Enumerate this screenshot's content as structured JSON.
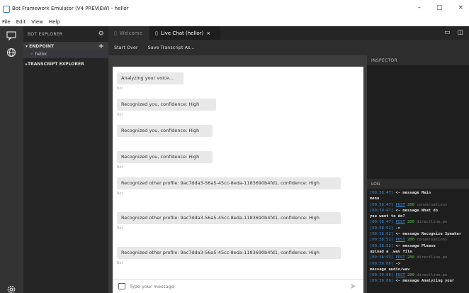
{
  "window": {
    "title": "Bot Framework Emulator (V4 PREVIEW) - hellor",
    "controls": [
      "–",
      "□",
      "×"
    ]
  },
  "menu": [
    "File",
    "Edit",
    "View",
    "Help"
  ],
  "sidebar": {
    "header": "BOT EXPLORER",
    "endpoint_section": "ENDPOINT",
    "endpoint_item": "hellor",
    "transcript_section": "TRANSCRIPT EXPLORER"
  },
  "tabs": [
    {
      "label": "Welcome"
    },
    {
      "label": "Live Chat (hellor)"
    }
  ],
  "toolbar": {
    "start_over": "Start Over",
    "save_transcript": "Save Transcript As..."
  },
  "chat": {
    "messages": [
      {
        "text": "Analyzing your voice...",
        "ts": "Bot"
      },
      {
        "text": "Recognized you, confidence: High",
        "ts": "Bot"
      },
      {
        "text": "Recognized you, confidence: High",
        "ts": ""
      },
      {
        "text": "Recognized you, confidence: High",
        "ts": "Bot"
      },
      {
        "text": "Recognized other profile: 9ac7dda3-56a5-45cc-8eda-1183690b4fd1, confidence: High",
        "ts": "Bot"
      },
      {
        "text": "Recognized other profile: 9ac7dda3-56a5-45cc-8eda-1183690b4fd1, confidence: High",
        "ts": "Bot"
      },
      {
        "text": "Recognized other profile: 9ac7dda3-56a5-45cc-8eda-1183690b4fd1, confidence: High",
        "ts": "Bot"
      }
    ],
    "input_placeholder": "Type your message"
  },
  "inspector": {
    "header": "INSPECTOR"
  },
  "log": {
    "header": "LOG",
    "lines": [
      {
        "ts": "[09:58:47]",
        "code": "",
        "link": "",
        "text": "<- message Main"
      },
      {
        "ts": "",
        "code": "",
        "link": "",
        "text": "menu"
      },
      {
        "ts": "[09:58:47]",
        "code": "200",
        "link": "POST",
        "text": "conversations"
      },
      {
        "ts": "[09:58:47]",
        "code": "",
        "link": "",
        "text": "<- message What do"
      },
      {
        "ts": "",
        "code": "",
        "link": "",
        "text": "you want to do?"
      },
      {
        "ts": "[09:58:47]",
        "code": "200",
        "link": "POST",
        "text": "directline.po"
      },
      {
        "ts": "[09:58:52]",
        "code": "",
        "link": "",
        "text": "->"
      },
      {
        "ts": "[09:58:52]",
        "code": "",
        "link": "",
        "text": "<- message Recognize Speaker"
      },
      {
        "ts": "[09:58:52]",
        "code": "200",
        "link": "POST",
        "text": "conversations"
      },
      {
        "ts": "[09:58:52]",
        "code": "",
        "link": "",
        "text": "<- message Please"
      },
      {
        "ts": "",
        "code": "",
        "link": "",
        "text": "upload a .wav file"
      },
      {
        "ts": "[09:58:53]",
        "code": "200",
        "link": "POST",
        "text": "directline.po"
      },
      {
        "ts": "[09:59:06]",
        "code": "",
        "link": "",
        "text": "->"
      },
      {
        "ts": "",
        "code": "",
        "link": "",
        "text": "message audio/wav"
      },
      {
        "ts": "[09:59:06]",
        "code": "200",
        "link": "POST",
        "text": "directline.po"
      },
      {
        "ts": "[09:59:06]",
        "code": "",
        "link": "",
        "text": "<- message Analyzing your"
      }
    ]
  }
}
